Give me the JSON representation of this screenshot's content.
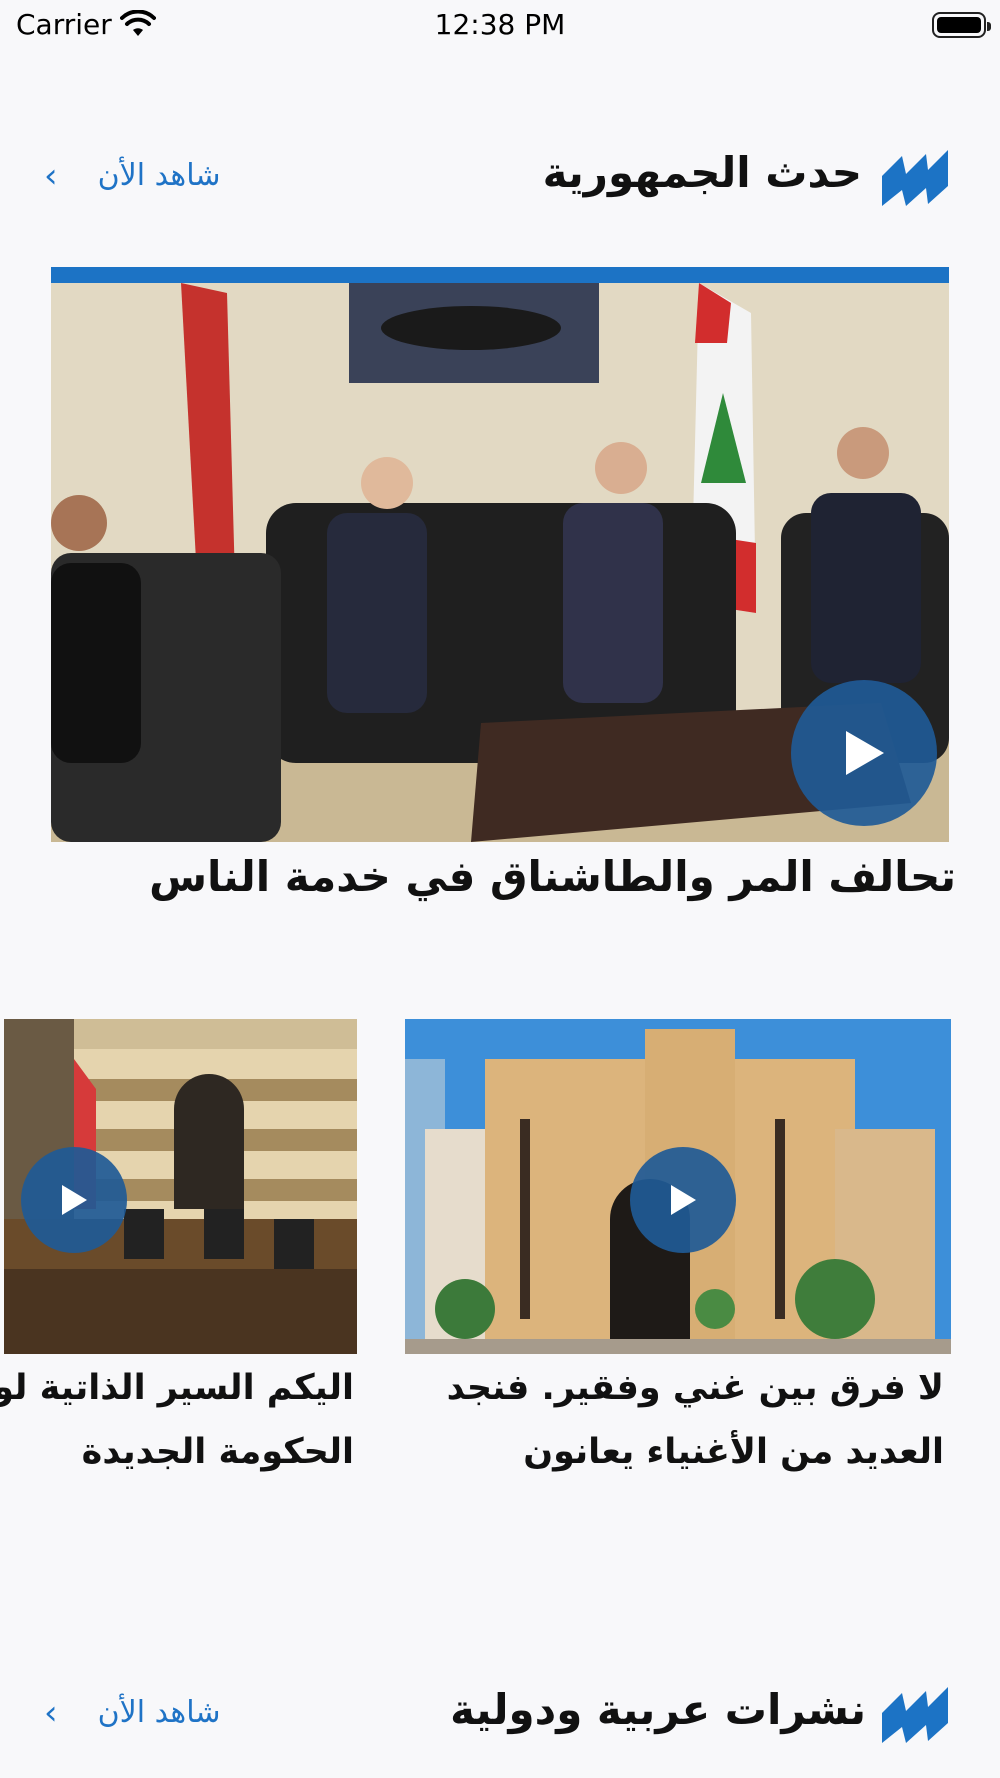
{
  "status_bar": {
    "carrier": "Carrier",
    "time": "12:38 PM"
  },
  "colors": {
    "accent": "#1c73c5",
    "link": "#1f73c6",
    "background": "#f8f8fa"
  },
  "section1": {
    "title": "حدث الجمهورية",
    "watch_now": "شاهد الأن",
    "featured": {
      "title": "تحالف المر والطاشناق في خدمة الناس",
      "icon": "play-icon"
    },
    "cards": [
      {
        "title_line1": "لا فرق بين غني وفقير. فنجد",
        "title_line2": "العديد من الأغنياء  يعانون",
        "icon": "play-icon"
      },
      {
        "title_line1": "اليكم السير الذاتية لوزراء",
        "title_line2": "الحكومة الجديدة",
        "icon": "play-icon"
      }
    ]
  },
  "section2": {
    "title": "نشرات عربية ودولية",
    "watch_now": "شاهد الأن"
  }
}
